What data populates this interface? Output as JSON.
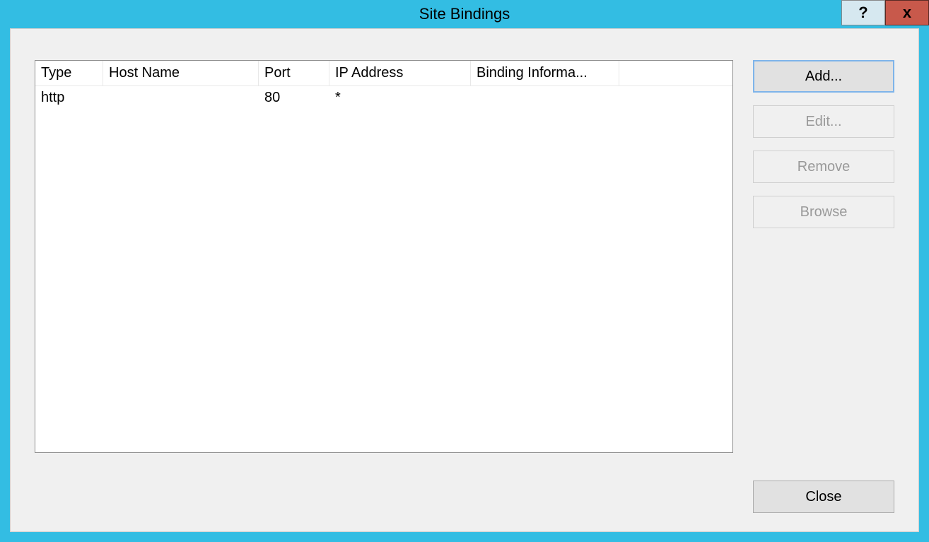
{
  "window": {
    "title": "Site Bindings",
    "help": "?",
    "close": "x"
  },
  "table": {
    "headers": {
      "type": "Type",
      "host": "Host Name",
      "port": "Port",
      "ip": "IP Address",
      "info": "Binding Informa..."
    },
    "rows": [
      {
        "type": "http",
        "host": "",
        "port": "80",
        "ip": "*",
        "info": ""
      }
    ]
  },
  "buttons": {
    "add": "Add...",
    "edit": "Edit...",
    "remove": "Remove",
    "browse": "Browse",
    "close": "Close"
  }
}
